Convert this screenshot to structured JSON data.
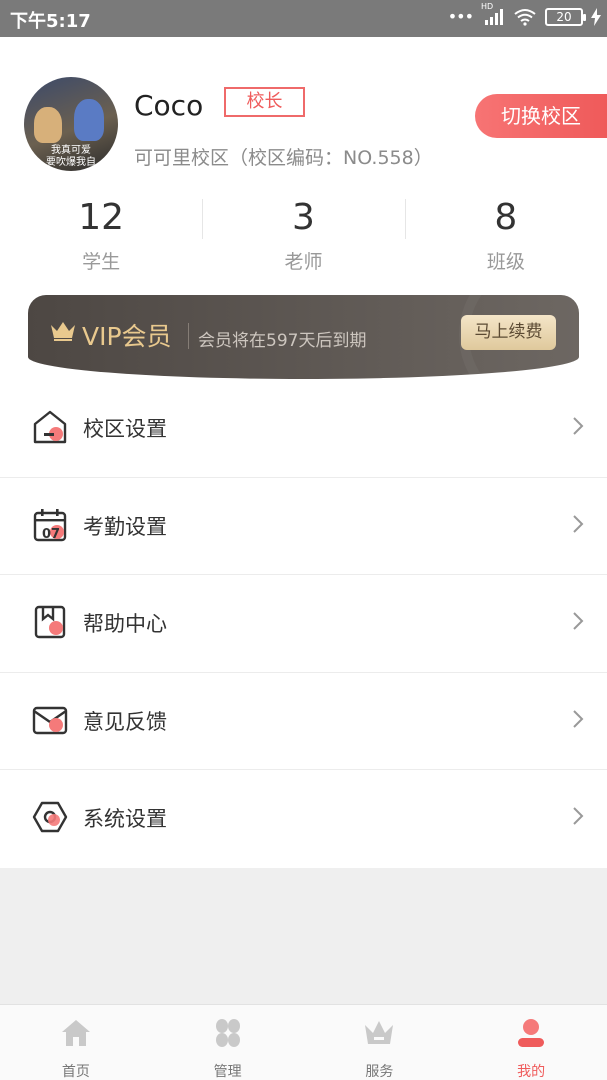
{
  "status_bar": {
    "time": "下午5:17",
    "signal_label": "HD",
    "battery": "20"
  },
  "profile": {
    "name": "Coco",
    "role": "校长",
    "campus": "可可里校区（校区编码：NO.558）",
    "switch_button": "切换校区",
    "avatar_caption_line1": "我真可爱",
    "avatar_caption_line2": "要吹爆我自"
  },
  "stats": [
    {
      "value": "12",
      "label": "学生"
    },
    {
      "value": "3",
      "label": "老师"
    },
    {
      "value": "8",
      "label": "班级"
    }
  ],
  "vip": {
    "title": "VIP会员",
    "description": "会员将在597天后到期",
    "renew_button": "马上续费"
  },
  "menu": [
    {
      "label": "校区设置",
      "icon": "home-icon"
    },
    {
      "label": "考勤设置",
      "icon": "calendar-icon",
      "icon_text": "07"
    },
    {
      "label": "帮助中心",
      "icon": "book-icon"
    },
    {
      "label": "意见反馈",
      "icon": "mail-icon"
    },
    {
      "label": "系统设置",
      "icon": "hexagon-settings-icon"
    }
  ],
  "tabbar": [
    {
      "label": "首页",
      "icon": "home-icon",
      "active": false
    },
    {
      "label": "管理",
      "icon": "grid-icon",
      "active": false
    },
    {
      "label": "服务",
      "icon": "crown-icon",
      "active": false
    },
    {
      "label": "我的",
      "icon": "user-icon",
      "active": true
    }
  ],
  "colors": {
    "accent": "#ef5b5b",
    "vip_gold": "#e9c98e",
    "status_bar": "#7a7a7a"
  }
}
